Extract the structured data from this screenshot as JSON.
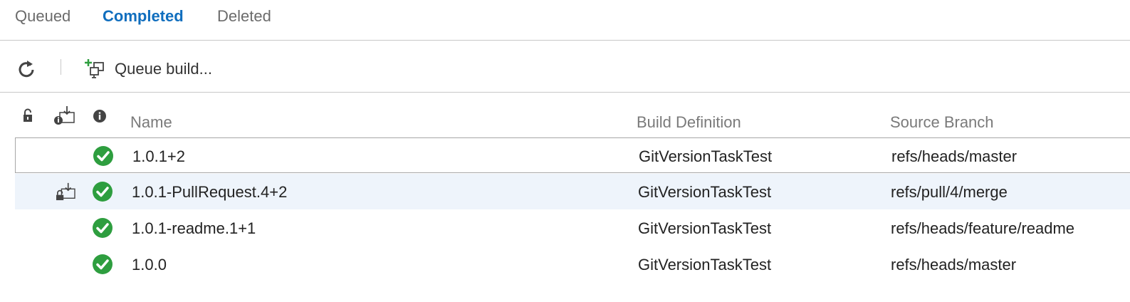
{
  "tabs": [
    {
      "label": "Queued",
      "active": false
    },
    {
      "label": "Completed",
      "active": true
    },
    {
      "label": "Deleted",
      "active": false
    }
  ],
  "toolbar": {
    "refresh_icon": "refresh-icon",
    "queue_build_label": "Queue build...",
    "queue_build_icon": "queue-build-icon"
  },
  "table": {
    "header_icons": [
      "lock-icon",
      "retained-icon",
      "info-icon"
    ],
    "columns": [
      "Name",
      "Build Definition",
      "Source Branch"
    ],
    "rows": [
      {
        "name": "1.0.1+2",
        "definition": "GitVersionTaskTest",
        "branch": "refs/heads/master",
        "status": "succeeded",
        "retained": false,
        "selected": true
      },
      {
        "name": "1.0.1-PullRequest.4+2",
        "definition": "GitVersionTaskTest",
        "branch": "refs/pull/4/merge",
        "status": "succeeded",
        "retained": true,
        "hover": true
      },
      {
        "name": "1.0.1-readme.1+1",
        "definition": "GitVersionTaskTest",
        "branch": "refs/heads/feature/readme",
        "status": "succeeded",
        "retained": false
      },
      {
        "name": "1.0.0",
        "definition": "GitVersionTaskTest",
        "branch": "refs/heads/master",
        "status": "succeeded",
        "retained": false
      }
    ]
  },
  "colors": {
    "accent": "#106ebe",
    "success": "#2e9e3f",
    "hover_row": "#eef4fb"
  }
}
